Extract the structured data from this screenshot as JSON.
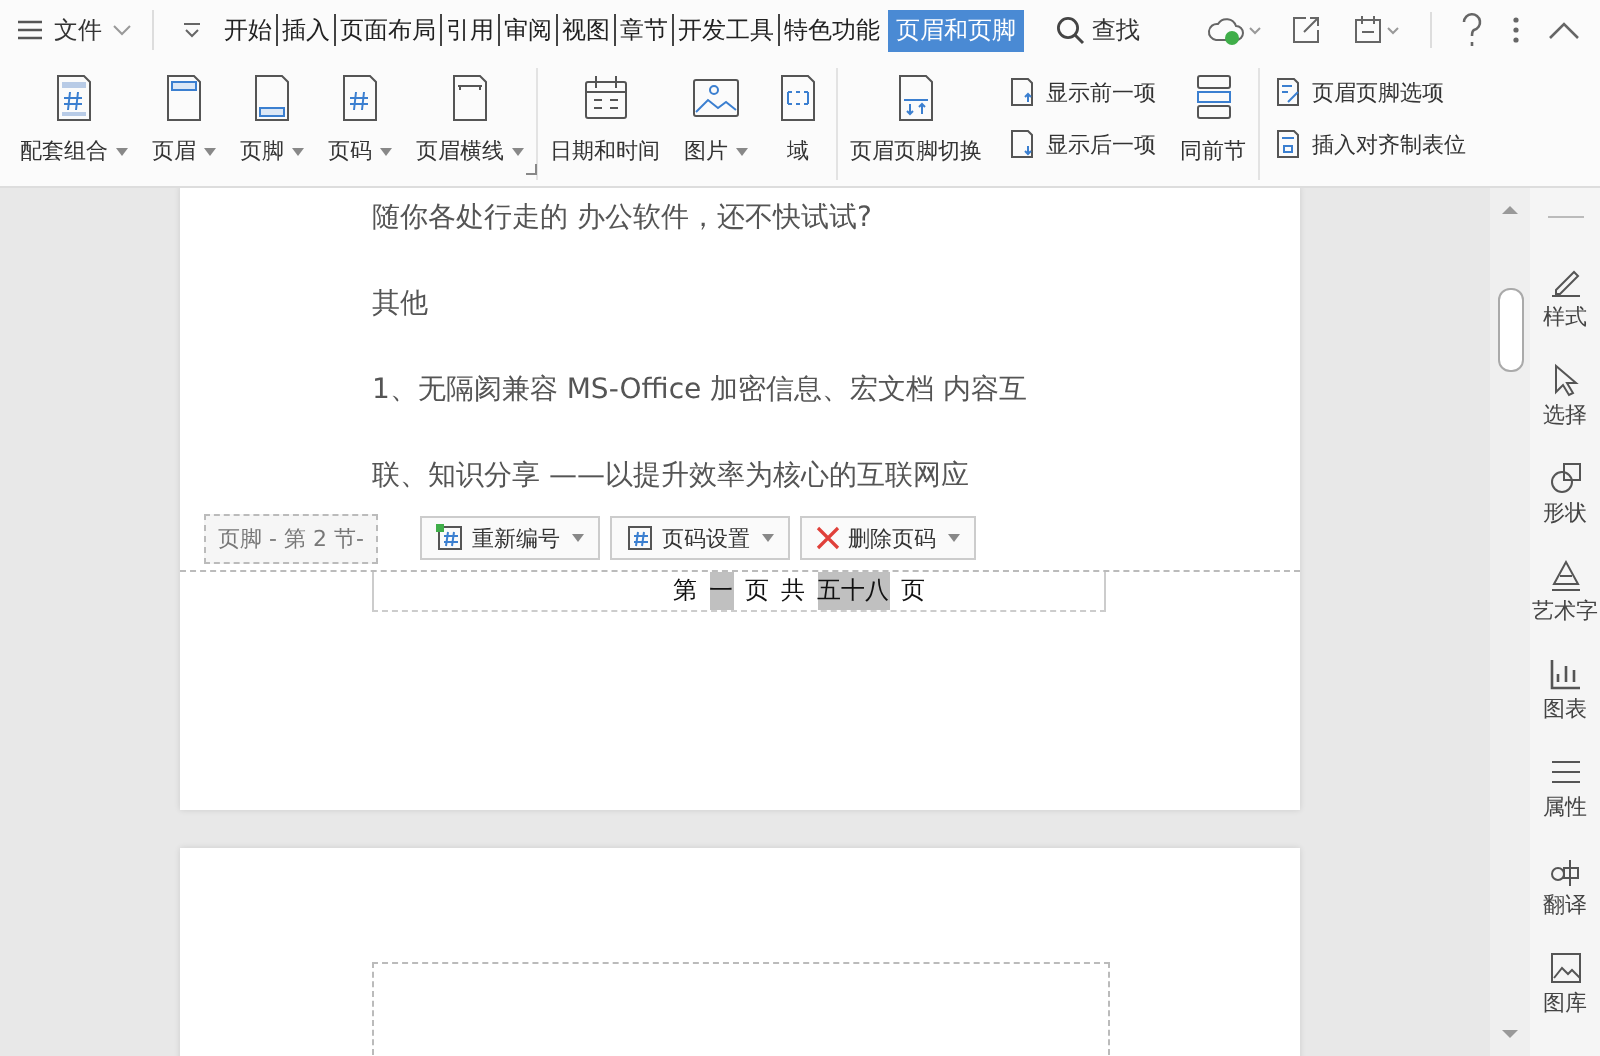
{
  "menu": {
    "label": "文件"
  },
  "tabs": [
    {
      "label": "开始",
      "selected": false
    },
    {
      "label": "插入",
      "selected": false
    },
    {
      "label": "页面布局",
      "selected": false
    },
    {
      "label": "引用",
      "selected": false
    },
    {
      "label": "审阅",
      "selected": false
    },
    {
      "label": "视图",
      "selected": false
    },
    {
      "label": "章节",
      "selected": false
    },
    {
      "label": "开发工具",
      "selected": false
    },
    {
      "label": "特色功能",
      "selected": false
    },
    {
      "label": "页眉和页脚",
      "selected": true
    }
  ],
  "search": {
    "label": "查找"
  },
  "ribbon": {
    "groups": [
      [
        {
          "label": "配套组合",
          "dropdown": true
        },
        {
          "label": "页眉",
          "dropdown": true
        },
        {
          "label": "页脚",
          "dropdown": true
        },
        {
          "label": "页码",
          "dropdown": true
        },
        {
          "label": "页眉横线",
          "dropdown": true
        }
      ],
      [
        {
          "label": "日期和时间",
          "dropdown": false
        },
        {
          "label": "图片",
          "dropdown": true
        },
        {
          "label": "域",
          "dropdown": false
        }
      ],
      [
        {
          "label": "页眉页脚切换",
          "dropdown": false
        },
        {
          "kind": "stack",
          "items": [
            "显示前一项",
            "显示后一项"
          ]
        },
        {
          "label": "同前节",
          "dropdown": false
        }
      ],
      [
        {
          "kind": "stack",
          "items": [
            "页眉页脚选项",
            "插入对齐制表位"
          ]
        }
      ]
    ]
  },
  "document": {
    "lines": [
      "随你各处行走的 办公软件，还不快试试?",
      "其他",
      "1、无隔阂兼容 MS-Office 加密信息、宏文档  内容互",
      "联、知识分享  ——以提升效率为核心的互联网应"
    ],
    "footer_tag": "页脚  - 第 2 节-",
    "footer_buttons": [
      {
        "label": "重新编号",
        "dropdown": true
      },
      {
        "label": "页码设置",
        "dropdown": true
      },
      {
        "label": "删除页码",
        "dropdown": true
      }
    ],
    "footer_text": [
      {
        "text": "第",
        "field": false
      },
      {
        "text": "一",
        "field": true
      },
      {
        "text": "页",
        "field": false
      },
      {
        "text": "共",
        "field": false
      },
      {
        "text": "五十八",
        "field": true
      },
      {
        "text": "页",
        "field": false
      }
    ]
  },
  "sidebar": [
    "样式",
    "选择",
    "形状",
    "艺术字",
    "图表",
    "属性",
    "翻译",
    "图库"
  ]
}
